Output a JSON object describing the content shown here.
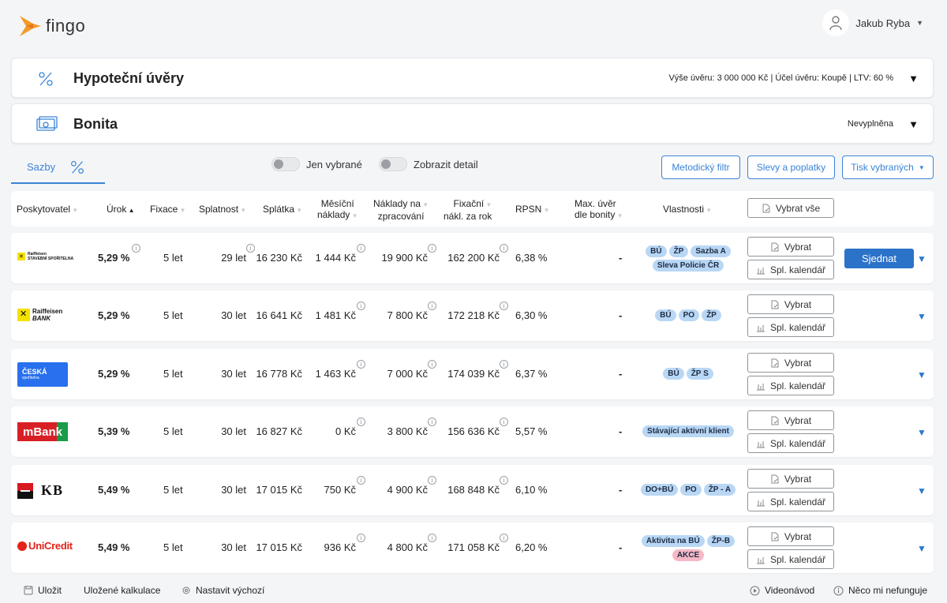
{
  "brand": {
    "name": "fingo",
    "accent": "#f39a2b"
  },
  "user": {
    "name": "Jakub Ryba"
  },
  "cards": {
    "mortgage": {
      "title": "Hypoteční úvěry",
      "info": "Výše úvěru: 3 000 000 Kč | Účel úvěru: Koupě | LTV: 60 %",
      "toggle": "▼"
    },
    "bonita": {
      "title": "Bonita",
      "info": "Nevyplněna",
      "toggle": "▼"
    }
  },
  "toolbar": {
    "tab_label": "Sazby",
    "toggle_selected": "Jen vybrané",
    "toggle_detail": "Zobrazit detail",
    "btn_method": "Metodický filtr",
    "btn_discounts": "Slevy a poplatky",
    "btn_print": "Tisk vybraných",
    "print_caret": "▼"
  },
  "columns": {
    "provider": "Poskytovatel",
    "rate": "Úrok",
    "fixation": "Fixace",
    "maturity": "Splatnost",
    "payment": "Splátka",
    "monthly_l1": "Měsíční",
    "monthly_l2": "náklady",
    "processing_l1": "Náklady na",
    "processing_l2": "zpracování",
    "fixcost_l1": "Fixační",
    "fixcost_l2": "nákl. za rok",
    "rpsn": "RPSN",
    "maxloan_l1": "Max. úvěr",
    "maxloan_l2": "dle bonity",
    "features": "Vlastnosti",
    "select_all": "Vybrat vše"
  },
  "actions": {
    "select": "Vybrat",
    "calendar": "Spl. kalendář",
    "negotiate": "Sjednat",
    "expand": "▼"
  },
  "rows": [
    {
      "bank": "Raiffeisen stavební spořitelna",
      "rate": "5,29 %",
      "fixation": "5 let",
      "maturity": "29 let",
      "payment": "16 230 Kč",
      "monthly": "1 444 Kč",
      "processing": "19 900 Kč",
      "fixcost": "162 200 Kč",
      "rpsn": "6,38 %",
      "maxloan": "-",
      "tags": [
        "BÚ",
        "ŽP",
        "Sazba A",
        "Sleva Policie ČR"
      ],
      "pink_tags": []
    },
    {
      "bank": "Raiffeisen BANK",
      "rate": "5,29 %",
      "fixation": "5 let",
      "maturity": "30 let",
      "payment": "16 641 Kč",
      "monthly": "1 481 Kč",
      "processing": "7 800 Kč",
      "fixcost": "172 218 Kč",
      "rpsn": "6,30 %",
      "maxloan": "-",
      "tags": [
        "BÚ",
        "PO",
        "ŽP"
      ],
      "pink_tags": []
    },
    {
      "bank": "Česká spořitelna",
      "rate": "5,29 %",
      "fixation": "5 let",
      "maturity": "30 let",
      "payment": "16 778 Kč",
      "monthly": "1 463 Kč",
      "processing": "7 000 Kč",
      "fixcost": "174 039 Kč",
      "rpsn": "6,37 %",
      "maxloan": "-",
      "tags": [
        "BÚ",
        "ŽP S"
      ],
      "pink_tags": []
    },
    {
      "bank": "mBank",
      "rate": "5,39 %",
      "fixation": "5 let",
      "maturity": "30 let",
      "payment": "16 827 Kč",
      "monthly": "0 Kč",
      "processing": "3 800 Kč",
      "fixcost": "156 636 Kč",
      "rpsn": "5,57 %",
      "maxloan": "-",
      "tags": [
        "Stávající aktivní klient"
      ],
      "pink_tags": []
    },
    {
      "bank": "KB",
      "rate": "5,49 %",
      "fixation": "5 let",
      "maturity": "30 let",
      "payment": "17 015 Kč",
      "monthly": "750 Kč",
      "processing": "4 900 Kč",
      "fixcost": "168 848 Kč",
      "rpsn": "6,10 %",
      "maxloan": "-",
      "tags": [
        "DO+BÚ",
        "PO",
        "ŽP - A"
      ],
      "pink_tags": []
    },
    {
      "bank": "UniCredit",
      "rate": "5,49 %",
      "fixation": "5 let",
      "maturity": "30 let",
      "payment": "17 015 Kč",
      "monthly": "936 Kč",
      "processing": "4 800 Kč",
      "fixcost": "171 058 Kč",
      "rpsn": "6,20 %",
      "maxloan": "-",
      "tags": [
        "Aktivita na BÚ",
        "ŽP-B"
      ],
      "pink_tags": [
        "AKCE"
      ]
    }
  ],
  "logos": {
    "rss_l1": "Raiffeisen",
    "rss_l2": "STAVEBNÍ SPOŘITELNA",
    "rb_l1": "Raiffeisen",
    "rb_l2": "BANK",
    "cs_l1": "ČESKÁ",
    "cs_l2": "spořitelna",
    "mbank": "mBank",
    "kb": "KB",
    "unicredit": "UniCredit"
  },
  "footer": {
    "save": "Uložit",
    "saved": "Uložené kalkulace",
    "default": "Nastavit výchozí",
    "video": "Videonávod",
    "issue": "Něco mi nefunguje"
  }
}
